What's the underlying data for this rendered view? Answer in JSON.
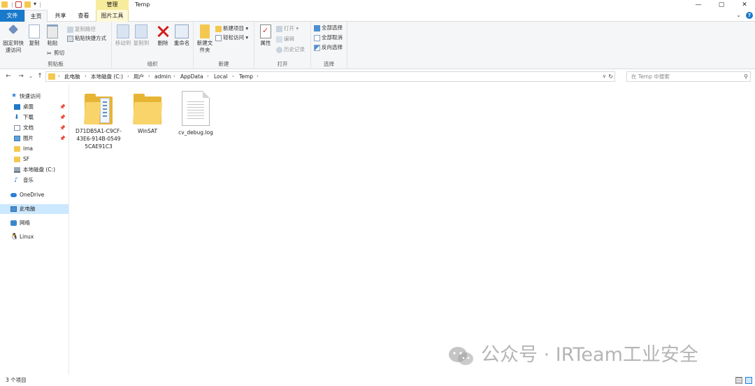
{
  "window": {
    "title": "Temp",
    "contextual_tab_header": "管理",
    "controls": {
      "minimize": "—",
      "maximize": "▢",
      "close": "✕"
    }
  },
  "ribbon_tabs": [
    "文件",
    "主页",
    "共享",
    "查看",
    "图片工具"
  ],
  "ribbon": {
    "clipboard": {
      "group_label": "剪贴板",
      "pin_label": "固定到快速访问",
      "copy_label": "复制",
      "paste_label": "粘贴",
      "copy_path": "复制路径",
      "paste_shortcut": "粘贴快捷方式",
      "cut": "剪切"
    },
    "organize": {
      "group_label": "组织",
      "move_to": "移动到",
      "copy_to": "复制到",
      "delete": "删除",
      "rename": "重命名"
    },
    "new": {
      "group_label": "新建",
      "new_folder": "新建文件夹",
      "new_item": "新建项目 ▾",
      "easy_access": "轻松访问 ▾"
    },
    "open": {
      "group_label": "打开",
      "properties": "属性",
      "open": "打开 ▾",
      "edit": "编辑",
      "history": "历史记录"
    },
    "select": {
      "group_label": "选择",
      "select_all": "全部选择",
      "select_none": "全部取消",
      "invert": "反向选择"
    }
  },
  "addressbar": {
    "breadcrumbs": [
      "此电脑",
      "本地磁盘 (C:)",
      "用户",
      "admin",
      "AppData",
      "Local",
      "Temp"
    ],
    "search_placeholder": "在 Temp 中搜索"
  },
  "navpane": {
    "items": [
      {
        "label": "快速访问",
        "icon": "star-icon",
        "pinned": false
      },
      {
        "label": "桌面",
        "icon": "desktop-icon",
        "pinned": true
      },
      {
        "label": "下载",
        "icon": "download-icon",
        "pinned": true
      },
      {
        "label": "文档",
        "icon": "document-icon",
        "pinned": true
      },
      {
        "label": "图片",
        "icon": "picture-icon",
        "pinned": true
      },
      {
        "label": "ima",
        "icon": "folder-icon",
        "pinned": false
      },
      {
        "label": "SF",
        "icon": "folder-icon",
        "pinned": false
      },
      {
        "label": "本地磁盘 (C:)",
        "icon": "drive-icon",
        "pinned": false
      },
      {
        "label": "音乐",
        "icon": "music-icon",
        "pinned": false
      },
      {
        "label": "OneDrive",
        "icon": "cloud-icon",
        "pinned": false
      },
      {
        "label": "此电脑",
        "icon": "pc-icon",
        "pinned": false,
        "selected": true
      },
      {
        "label": "网络",
        "icon": "network-icon",
        "pinned": false
      },
      {
        "label": "Linux",
        "icon": "linux-icon",
        "pinned": false
      }
    ]
  },
  "files": [
    {
      "name": "D71DB5A1-C9CF-43E6-914B-05495CAE91C3",
      "type": "folder-with-files"
    },
    {
      "name": "WinSAT",
      "type": "folder"
    },
    {
      "name": "cv_debug.log",
      "type": "text-file"
    }
  ],
  "statusbar": {
    "count": "3 个项目"
  },
  "watermark": {
    "text": "公众号 · IRTeam工业安全"
  },
  "colors": {
    "accent": "#1979ca",
    "folder": "#f4c850",
    "selected": "#cce8ff",
    "contextual": "#f7eb9c"
  }
}
